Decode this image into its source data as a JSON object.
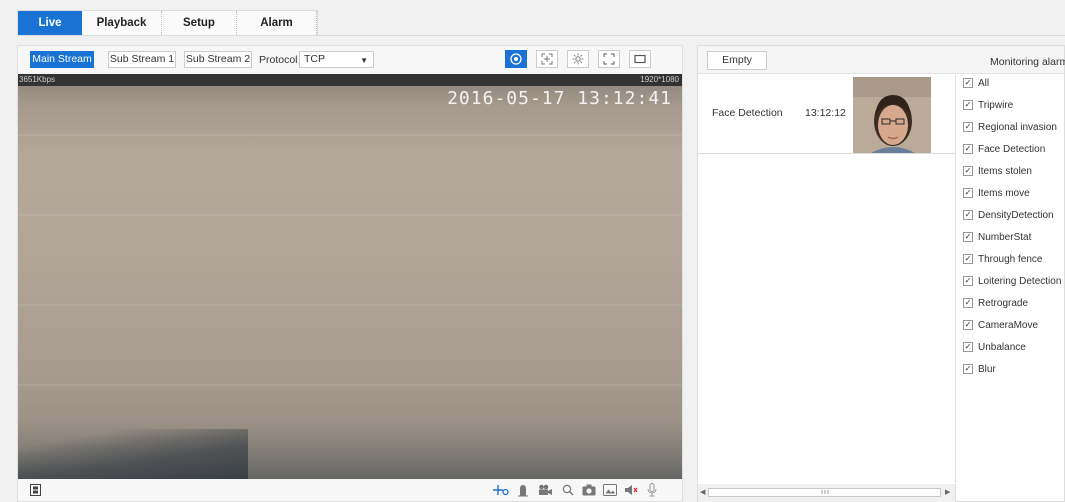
{
  "tabs": [
    {
      "label": "Live",
      "active": true
    },
    {
      "label": "Playback",
      "active": false
    },
    {
      "label": "Setup",
      "active": false
    },
    {
      "label": "Alarm",
      "active": false
    }
  ],
  "stream": {
    "main": "Main Stream",
    "sub1": "Sub Stream 1",
    "sub2": "Sub Stream 2",
    "protocol_label": "Protocol",
    "protocol_value": "TCP"
  },
  "video": {
    "bitrate": "3651Kbps",
    "resolution": "1920*1080",
    "timestamp": "2016-05-17 13:12:41"
  },
  "right_panel": {
    "empty_button": "Empty",
    "monitoring_label": "Monitoring alarm",
    "alarms": [
      {
        "type": "Face Detection",
        "time": "13:12:12"
      }
    ],
    "checkboxes": [
      {
        "label": "All",
        "checked": true
      },
      {
        "label": "Tripwire",
        "checked": true
      },
      {
        "label": "Regional invasion",
        "checked": true
      },
      {
        "label": "Face Detection",
        "checked": true
      },
      {
        "label": "Items stolen",
        "checked": true
      },
      {
        "label": "Items move",
        "checked": true
      },
      {
        "label": "DensityDetection",
        "checked": true
      },
      {
        "label": "NumberStat",
        "checked": true
      },
      {
        "label": "Through fence",
        "checked": true
      },
      {
        "label": "Loitering Detection",
        "checked": true
      },
      {
        "label": "Retrograde",
        "checked": true
      },
      {
        "label": "CameraMove",
        "checked": true
      },
      {
        "label": "Unbalance",
        "checked": true
      },
      {
        "label": "Blur",
        "checked": true
      }
    ]
  },
  "colors": {
    "accent": "#1a73d4"
  },
  "icons": {
    "toolbar": [
      "eye-icon",
      "crosshair-icon",
      "brightness-icon",
      "fullscreen-icon",
      "window-icon"
    ],
    "bottom": [
      "film-icon",
      "ptz-icon",
      "person-icon",
      "record-icon",
      "zoom-icon",
      "snapshot-icon",
      "image-icon",
      "audio-icon",
      "microphone-icon"
    ]
  }
}
